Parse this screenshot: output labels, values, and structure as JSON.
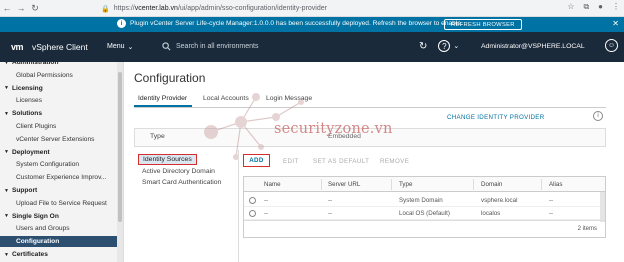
{
  "browser": {
    "url_prefix": "https://",
    "url_host": "vcenter.lab.vn",
    "url_path": "/ui/app/admin/sso-configuration/identity-provider"
  },
  "banner": {
    "message": "Plugin vCenter Server Life-cycle Manager:1.0.0.0 has been successfully deployed. Refresh the browser to enable.",
    "button": "REFRESH BROWSER",
    "color": "#0072a3"
  },
  "header": {
    "logo": "vm",
    "app_title": "vSphere Client",
    "menu": "Menu",
    "search_placeholder": "Search in all environments",
    "user": "Administrator@VSPHERE.LOCAL",
    "bg_color": "#1b2a3b"
  },
  "sidebar": {
    "items": [
      {
        "label": "Administration",
        "kind": "section"
      },
      {
        "label": "Global Permissions",
        "kind": "child"
      },
      {
        "label": "Licensing",
        "kind": "section"
      },
      {
        "label": "Licenses",
        "kind": "child"
      },
      {
        "label": "Solutions",
        "kind": "section"
      },
      {
        "label": "Client Plugins",
        "kind": "child"
      },
      {
        "label": "vCenter Server Extensions",
        "kind": "child"
      },
      {
        "label": "Deployment",
        "kind": "section"
      },
      {
        "label": "System Configuration",
        "kind": "child"
      },
      {
        "label": "Customer Experience Improv...",
        "kind": "child"
      },
      {
        "label": "Support",
        "kind": "section"
      },
      {
        "label": "Upload File to Service Request",
        "kind": "child"
      },
      {
        "label": "Single Sign On",
        "kind": "section"
      },
      {
        "label": "Users and Groups",
        "kind": "child"
      },
      {
        "label": "Configuration",
        "kind": "child-active"
      },
      {
        "label": "Certificates",
        "kind": "section"
      }
    ]
  },
  "main": {
    "title": "Configuration",
    "tabs": [
      "Identity Provider",
      "Local Accounts",
      "Login Message"
    ],
    "change_link": "CHANGE IDENTITY PROVIDER",
    "type_label": "Type",
    "type_value": "Embedded",
    "sources": [
      "Identity Sources",
      "Active Directory Domain",
      "Smart Card Authentication"
    ],
    "actions": {
      "add": "ADD",
      "edit": "EDIT",
      "set_default": "SET AS DEFAULT",
      "remove": "REMOVE"
    },
    "table": {
      "columns": [
        "Name",
        "Server URL",
        "Type",
        "Domain",
        "Alias"
      ],
      "rows": [
        [
          "--",
          "--",
          "System Domain",
          "vsphere.local",
          "--"
        ],
        [
          "--",
          "--",
          "Local OS (Default)",
          "localos",
          "--"
        ]
      ],
      "count": "2 items"
    }
  },
  "watermark": {
    "text": "securityzone.vn",
    "color": "#c96b6b"
  }
}
